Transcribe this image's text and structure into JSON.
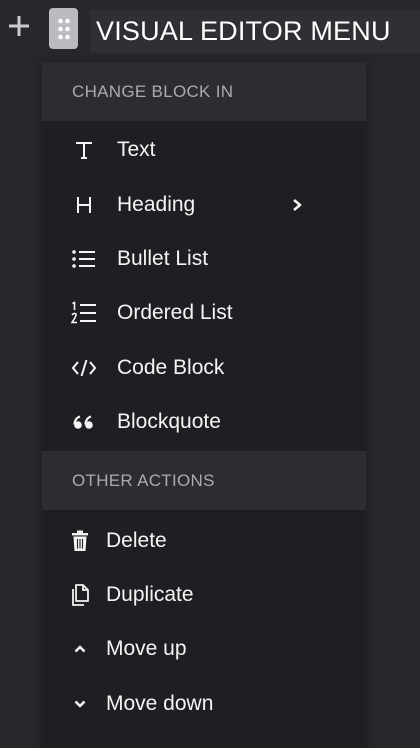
{
  "header": {
    "title": "VISUAL EDITOR MENU"
  },
  "icons": {
    "add": "plus-icon",
    "drag": "drag-handle-icon"
  },
  "menu": {
    "change_block": {
      "label": "CHANGE BLOCK IN",
      "items": [
        {
          "label": "Text",
          "icon": "text-icon"
        },
        {
          "label": "Heading",
          "icon": "heading-icon",
          "has_submenu": true
        },
        {
          "label": "Bullet List",
          "icon": "bullet-list-icon"
        },
        {
          "label": "Ordered List",
          "icon": "ordered-list-icon"
        },
        {
          "label": "Code Block",
          "icon": "code-icon"
        },
        {
          "label": "Blockquote",
          "icon": "quote-icon"
        }
      ]
    },
    "other_actions": {
      "label": "OTHER ACTIONS",
      "items": [
        {
          "label": "Delete",
          "icon": "trash-icon"
        },
        {
          "label": "Duplicate",
          "icon": "copy-icon"
        },
        {
          "label": "Move up",
          "icon": "chevron-up-icon"
        },
        {
          "label": "Move down",
          "icon": "chevron-down-icon"
        }
      ]
    }
  },
  "colors": {
    "page_bg": "#27282c",
    "menu_bg": "#1e1f22",
    "section_bg": "#2c2d31",
    "section_text": "#a9abb0",
    "item_text": "#f4f4f4",
    "drag_handle_bg": "#b9bbbe"
  }
}
